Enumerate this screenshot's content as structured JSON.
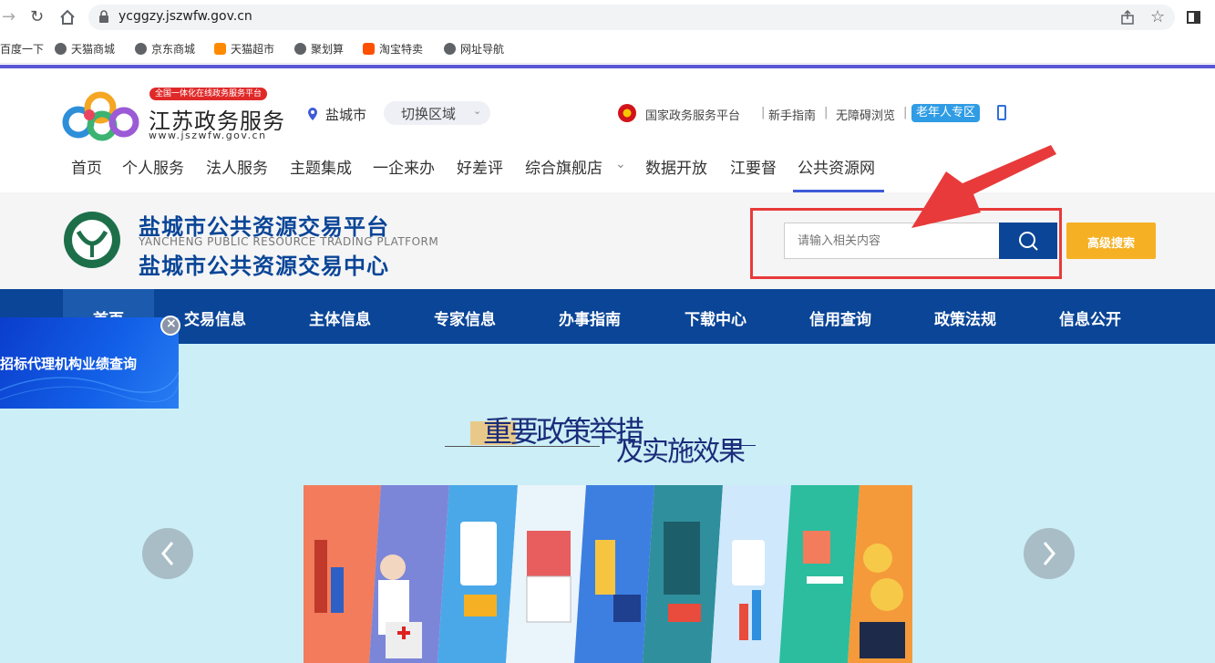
{
  "browser": {
    "url": "ycggzy.jszwfw.gov.cn",
    "bookmarks": [
      "百度一下",
      "天猫商城",
      "京东商城",
      "天猫超市",
      "聚划算",
      "淘宝特卖",
      "网址导航"
    ]
  },
  "gov_header": {
    "logo_badge": "全国一体化在线政务服务平台",
    "logo_title": "江苏政务服务",
    "logo_domain": "www.jszwfw.gov.cn",
    "city": "盐城市",
    "switch_region": "切换区域",
    "top_links": [
      "国家政务服务平台",
      "新手指南",
      "无障碍浏览"
    ],
    "elder_zone": "老年人专区",
    "nav": [
      "首页",
      "个人服务",
      "法人服务",
      "主题集成",
      "一企来办",
      "好差评",
      "综合旗舰店",
      "数据开放",
      "江要督",
      "公共资源网"
    ],
    "active_nav": "公共资源网"
  },
  "platform": {
    "title_cn": "盐城市公共资源交易平台",
    "title_en": "YANCHENG PUBLIC RESOURCE TRADING PLATFORM",
    "subtitle_cn": "盐城市公共资源交易中心",
    "search_placeholder": "请输入相关内容",
    "advanced_search": "高级搜索",
    "nav": [
      "首页",
      "交易信息",
      "主体信息",
      "专家信息",
      "办事指南",
      "下载中心",
      "信用查询",
      "政策法规",
      "信息公开"
    ]
  },
  "floating_ad": {
    "text": "招标代理机构业绩查询"
  },
  "banner": {
    "heading_line1": "重要政策举措",
    "heading_line2": "及实施效果"
  },
  "colors": {
    "primary_nav_bg": "#0a4597",
    "accent_orange": "#f5b023",
    "annotation_red": "#e83a3a",
    "content_bg": "#cceef6",
    "purple_line": "#5b56d6"
  }
}
